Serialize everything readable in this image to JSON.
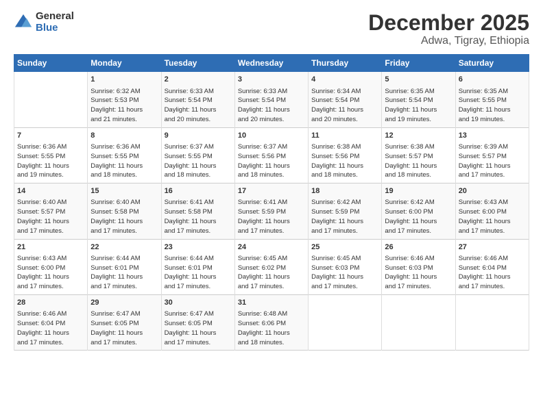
{
  "logo": {
    "general": "General",
    "blue": "Blue"
  },
  "title": "December 2025",
  "location": "Adwa, Tigray, Ethiopia",
  "days_of_week": [
    "Sunday",
    "Monday",
    "Tuesday",
    "Wednesday",
    "Thursday",
    "Friday",
    "Saturday"
  ],
  "weeks": [
    [
      {
        "day": "",
        "info": ""
      },
      {
        "day": "1",
        "info": "Sunrise: 6:32 AM\nSunset: 5:53 PM\nDaylight: 11 hours\nand 21 minutes."
      },
      {
        "day": "2",
        "info": "Sunrise: 6:33 AM\nSunset: 5:54 PM\nDaylight: 11 hours\nand 20 minutes."
      },
      {
        "day": "3",
        "info": "Sunrise: 6:33 AM\nSunset: 5:54 PM\nDaylight: 11 hours\nand 20 minutes."
      },
      {
        "day": "4",
        "info": "Sunrise: 6:34 AM\nSunset: 5:54 PM\nDaylight: 11 hours\nand 20 minutes."
      },
      {
        "day": "5",
        "info": "Sunrise: 6:35 AM\nSunset: 5:54 PM\nDaylight: 11 hours\nand 19 minutes."
      },
      {
        "day": "6",
        "info": "Sunrise: 6:35 AM\nSunset: 5:55 PM\nDaylight: 11 hours\nand 19 minutes."
      }
    ],
    [
      {
        "day": "7",
        "info": "Sunrise: 6:36 AM\nSunset: 5:55 PM\nDaylight: 11 hours\nand 19 minutes."
      },
      {
        "day": "8",
        "info": "Sunrise: 6:36 AM\nSunset: 5:55 PM\nDaylight: 11 hours\nand 18 minutes."
      },
      {
        "day": "9",
        "info": "Sunrise: 6:37 AM\nSunset: 5:55 PM\nDaylight: 11 hours\nand 18 minutes."
      },
      {
        "day": "10",
        "info": "Sunrise: 6:37 AM\nSunset: 5:56 PM\nDaylight: 11 hours\nand 18 minutes."
      },
      {
        "day": "11",
        "info": "Sunrise: 6:38 AM\nSunset: 5:56 PM\nDaylight: 11 hours\nand 18 minutes."
      },
      {
        "day": "12",
        "info": "Sunrise: 6:38 AM\nSunset: 5:57 PM\nDaylight: 11 hours\nand 18 minutes."
      },
      {
        "day": "13",
        "info": "Sunrise: 6:39 AM\nSunset: 5:57 PM\nDaylight: 11 hours\nand 17 minutes."
      }
    ],
    [
      {
        "day": "14",
        "info": "Sunrise: 6:40 AM\nSunset: 5:57 PM\nDaylight: 11 hours\nand 17 minutes."
      },
      {
        "day": "15",
        "info": "Sunrise: 6:40 AM\nSunset: 5:58 PM\nDaylight: 11 hours\nand 17 minutes."
      },
      {
        "day": "16",
        "info": "Sunrise: 6:41 AM\nSunset: 5:58 PM\nDaylight: 11 hours\nand 17 minutes."
      },
      {
        "day": "17",
        "info": "Sunrise: 6:41 AM\nSunset: 5:59 PM\nDaylight: 11 hours\nand 17 minutes."
      },
      {
        "day": "18",
        "info": "Sunrise: 6:42 AM\nSunset: 5:59 PM\nDaylight: 11 hours\nand 17 minutes."
      },
      {
        "day": "19",
        "info": "Sunrise: 6:42 AM\nSunset: 6:00 PM\nDaylight: 11 hours\nand 17 minutes."
      },
      {
        "day": "20",
        "info": "Sunrise: 6:43 AM\nSunset: 6:00 PM\nDaylight: 11 hours\nand 17 minutes."
      }
    ],
    [
      {
        "day": "21",
        "info": "Sunrise: 6:43 AM\nSunset: 6:00 PM\nDaylight: 11 hours\nand 17 minutes."
      },
      {
        "day": "22",
        "info": "Sunrise: 6:44 AM\nSunset: 6:01 PM\nDaylight: 11 hours\nand 17 minutes."
      },
      {
        "day": "23",
        "info": "Sunrise: 6:44 AM\nSunset: 6:01 PM\nDaylight: 11 hours\nand 17 minutes."
      },
      {
        "day": "24",
        "info": "Sunrise: 6:45 AM\nSunset: 6:02 PM\nDaylight: 11 hours\nand 17 minutes."
      },
      {
        "day": "25",
        "info": "Sunrise: 6:45 AM\nSunset: 6:03 PM\nDaylight: 11 hours\nand 17 minutes."
      },
      {
        "day": "26",
        "info": "Sunrise: 6:46 AM\nSunset: 6:03 PM\nDaylight: 11 hours\nand 17 minutes."
      },
      {
        "day": "27",
        "info": "Sunrise: 6:46 AM\nSunset: 6:04 PM\nDaylight: 11 hours\nand 17 minutes."
      }
    ],
    [
      {
        "day": "28",
        "info": "Sunrise: 6:46 AM\nSunset: 6:04 PM\nDaylight: 11 hours\nand 17 minutes."
      },
      {
        "day": "29",
        "info": "Sunrise: 6:47 AM\nSunset: 6:05 PM\nDaylight: 11 hours\nand 17 minutes."
      },
      {
        "day": "30",
        "info": "Sunrise: 6:47 AM\nSunset: 6:05 PM\nDaylight: 11 hours\nand 17 minutes."
      },
      {
        "day": "31",
        "info": "Sunrise: 6:48 AM\nSunset: 6:06 PM\nDaylight: 11 hours\nand 18 minutes."
      },
      {
        "day": "",
        "info": ""
      },
      {
        "day": "",
        "info": ""
      },
      {
        "day": "",
        "info": ""
      }
    ]
  ]
}
